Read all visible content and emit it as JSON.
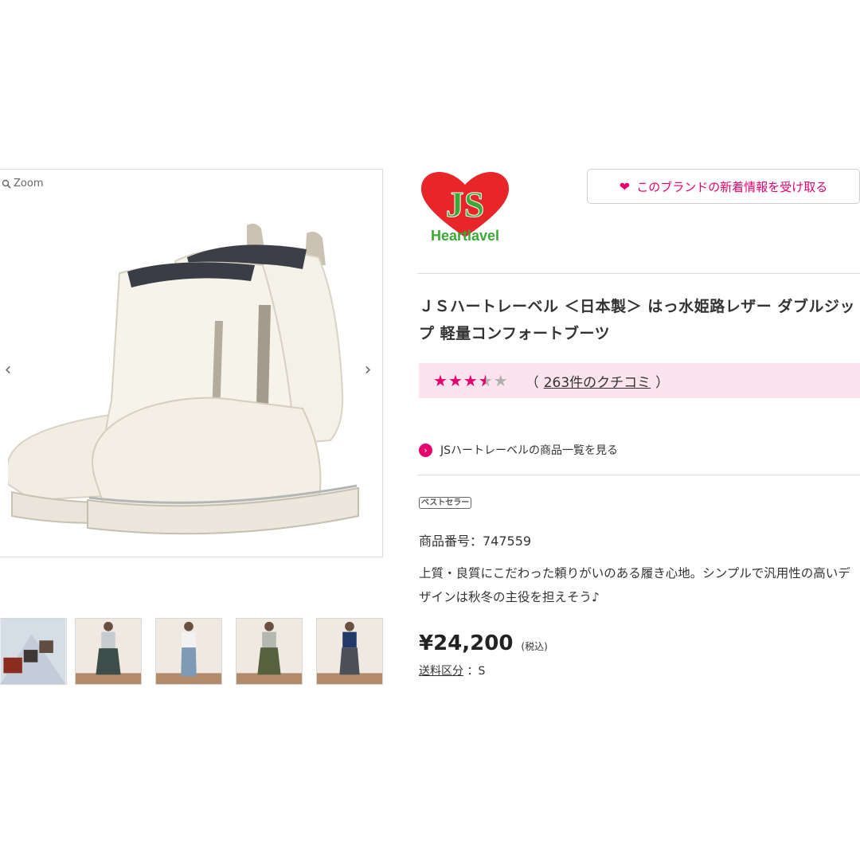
{
  "gallery": {
    "zoom_label": "Zoom",
    "prev_arrow": "‹",
    "next_arrow": "›",
    "thumbnails": [
      "thumb-1",
      "thumb-2",
      "thumb-3",
      "thumb-4",
      "thumb-5"
    ]
  },
  "brand": {
    "logo_letters": "JS",
    "logo_text": "Heartlavel",
    "follow_label": "このブランドの新着情報を受け取る",
    "brand_list_link": "JSハートレーベルの商品一覧を見る"
  },
  "product": {
    "title": "ＪＳハートレーベル ＜日本製＞ はっ水姫路レザー ダブルジップ 軽量コンフォートブーツ",
    "rating": 3.5,
    "rating_max": 5,
    "review_open": "（",
    "review_count_label": "263件のクチコミ",
    "review_close": "）",
    "badge": "ベストセラー",
    "product_no": "商品番号：747559",
    "description": "上質・良質にこだわった頼りがいのある履き心地。シンプルで汎用性の高いデザインは秋冬の主役を担えそう♪",
    "price": "¥24,200",
    "tax_label": "(税込)",
    "shipping_label": "送料区分",
    "shipping_value": "：S"
  },
  "colors": {
    "accent": "#e5006e",
    "rating_bg": "#fce4ee",
    "logo_red": "#e8262a",
    "logo_green": "#3aa935"
  }
}
